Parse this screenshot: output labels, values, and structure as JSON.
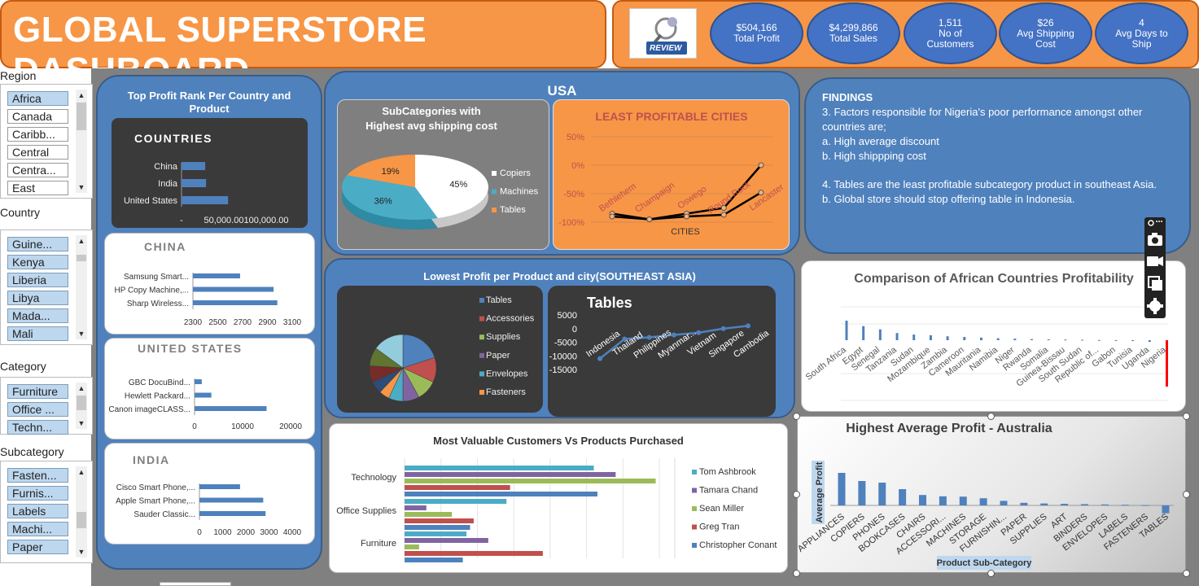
{
  "title": "GLOBAL SUPERSTORE DASHBOARD",
  "logo_text": "REVIEW",
  "kpis": [
    {
      "value": "$504,166",
      "label": "Total Profit"
    },
    {
      "value": "$4,299,866",
      "label": "Total Sales"
    },
    {
      "value": "1,511",
      "label": "No of Customers"
    },
    {
      "value": "$26",
      "label": "Avg Shipping Cost"
    },
    {
      "value": "4",
      "label": "Avg Days to Ship"
    }
  ],
  "slicers": {
    "region": {
      "title": "Region",
      "items": [
        "Africa",
        "Canada",
        "Caribb...",
        "Central",
        "Centra...",
        "East"
      ],
      "selected": [
        0
      ]
    },
    "country": {
      "title": "Country",
      "items": [
        "Guine...",
        "Kenya",
        "Liberia",
        "Libya",
        "Mada...",
        "Mali"
      ],
      "selected": [
        0,
        1,
        2,
        3,
        4,
        5
      ]
    },
    "category": {
      "title": "Category",
      "items": [
        "Furniture",
        "Office ...",
        "Techn..."
      ],
      "selected": [
        0,
        1,
        2
      ]
    },
    "subcategory": {
      "title": "Subcategory",
      "items": [
        "Fasten...",
        "Furnis...",
        "Labels",
        "Machi...",
        "Paper"
      ],
      "selected": [
        0,
        1,
        2,
        3,
        4
      ]
    }
  },
  "left_panel_title": "Top Profit Rank Per Country and Product",
  "usa_panel_title": "USA",
  "sea_panel_title": "Lowest Profit per Product and city(SOUTHEAST ASIA)",
  "findings": {
    "heading": "FINDINGS",
    "lines": [
      "3. Factors responsible for Nigeria's poor performance amongst other countries are;",
      "a. High average discount",
      "b. High shippping cost",
      "",
      "4. Tables are the least profitable subcategory product in southeast Asia.",
      "b. Global store should stop offering table in Indonesia."
    ]
  },
  "chart_data": [
    {
      "id": "countries",
      "type": "bar",
      "orientation": "horizontal",
      "title": "COUNTRIES",
      "categories": [
        "China",
        "India",
        "United States"
      ],
      "values": [
        28000,
        29000,
        55000
      ],
      "xlim": [
        0,
        100000
      ],
      "tick_labels": [
        "-",
        "50,000.00",
        "100,000.00"
      ],
      "colors": [
        "#4f81bd"
      ]
    },
    {
      "id": "china",
      "type": "bar",
      "orientation": "horizontal",
      "title": "CHINA",
      "categories": [
        "Samsung Smart...",
        "HP Copy Machine,...",
        "Sharp Wireless..."
      ],
      "values": [
        2680,
        2950,
        2980
      ],
      "xlim": [
        2300,
        3100
      ],
      "tick_labels": [
        "2300",
        "2500",
        "2700",
        "2900",
        "3100"
      ],
      "colors": [
        "#4f81bd"
      ]
    },
    {
      "id": "united_states",
      "type": "bar",
      "orientation": "horizontal",
      "title": "UNITED STATES",
      "categories": [
        "GBC DocuBind...",
        "Hewlett Packard...",
        "Canon imageCLASS..."
      ],
      "values": [
        1500,
        3500,
        15000
      ],
      "xlim": [
        0,
        20000
      ],
      "tick_labels": [
        "0",
        "10000",
        "20000"
      ],
      "colors": [
        "#4f81bd"
      ]
    },
    {
      "id": "india",
      "type": "bar",
      "orientation": "horizontal",
      "title": "INDIA",
      "categories": [
        "Cisco Smart Phone,...",
        "Apple Smart Phone,...",
        "Sauder Classic..."
      ],
      "values": [
        1750,
        2750,
        2850
      ],
      "xlim": [
        0,
        4000
      ],
      "tick_labels": [
        "0",
        "1000",
        "2000",
        "3000",
        "4000"
      ],
      "colors": [
        "#4f81bd"
      ]
    },
    {
      "id": "usa_shipping_pie",
      "type": "pie",
      "title": "SubCategories with Highest avg shipping cost",
      "categories": [
        "Copiers",
        "Machines",
        "Tables"
      ],
      "values": [
        45,
        36,
        19
      ],
      "labels": [
        "45%",
        "36%",
        "19%"
      ],
      "colors": [
        "#ffffff",
        "#4bacc6",
        "#f79646"
      ],
      "legend": "right"
    },
    {
      "id": "usa_least_profitable",
      "type": "line",
      "title": "LEAST PROFITABLE CITIES",
      "xlabel": "CITIES",
      "categories": [
        "Bethlehem",
        "Champaign",
        "Oswego",
        "Round Rock",
        "Lancaster"
      ],
      "series": [
        {
          "values": [
            -85,
            -95,
            -85,
            -75,
            0
          ],
          "color": "#000000"
        },
        {
          "values": [
            -90,
            -95,
            -90,
            -87,
            -48
          ],
          "color": "#000000"
        }
      ],
      "ylim": [
        -100,
        50
      ],
      "tick_labels": [
        "50%",
        "0%",
        "-50%",
        "-100%"
      ]
    },
    {
      "id": "sea_pie",
      "type": "pie",
      "categories": [
        "Tables",
        "Accessories",
        "Supplies",
        "Paper",
        "Envelopes",
        "Fasteners"
      ],
      "values": [
        20,
        12,
        10,
        8,
        7,
        5,
        6,
        8,
        9,
        15
      ],
      "colors": [
        "#4f81bd",
        "#c0504d",
        "#9bbb59",
        "#8064a2",
        "#4bacc6",
        "#f79646",
        "#2c4d75",
        "#772c2a",
        "#5f7530",
        "#93cddd"
      ],
      "legend": "right"
    },
    {
      "id": "sea_tables",
      "type": "line",
      "title": "Tables",
      "categories": [
        "Indonesia",
        "Thailand",
        "Philippines",
        "Myanmar...",
        "Vietnam",
        "Singapore",
        "Cambodia"
      ],
      "values": [
        -11000,
        -3800,
        -3200,
        -2300,
        -1500,
        0,
        1000
      ],
      "ylim": [
        -15000,
        5000
      ],
      "tick_labels": [
        "5000",
        "0",
        "-5000",
        "-10000",
        "-15000"
      ],
      "colors": [
        "#4f81bd"
      ]
    },
    {
      "id": "african_profitability",
      "type": "bar",
      "title": "Comparison of African Countries Profitability",
      "categories": [
        "South Africa",
        "Egypt",
        "Senegal",
        "Tanzania",
        "Sudan",
        "Mozambique",
        "Zambia",
        "Cameroon",
        "Mauritania",
        "Namibia",
        "Niger",
        "Rwanda",
        "Somalia",
        "Guinea-Bissau",
        "South Sudan",
        "Republic of...",
        "Gabon",
        "Tunisia",
        "Uganda",
        "Nigeria"
      ],
      "values": [
        9000,
        6500,
        5000,
        3300,
        2600,
        2300,
        1800,
        1500,
        1200,
        900,
        700,
        500,
        400,
        300,
        200,
        100,
        50,
        -100,
        -800,
        -3500
      ],
      "colors": [
        "#4f81bd",
        "#ff0000"
      ]
    },
    {
      "id": "australia_avg_profit",
      "type": "bar",
      "title": "Highest Average Profit - Australia",
      "xlabel": "Product Sub-Category",
      "ylabel": "Average Profit",
      "categories": [
        "APPLIANCES",
        "COPIERS",
        "PHONES",
        "BOOKCASES",
        "CHAIRS",
        "ACCESSORI...",
        "MACHINES",
        "STORAGE",
        "FURNISHIN...",
        "PAPER",
        "SUPPLIES",
        "ART",
        "BINDERS",
        "ENVELOPES",
        "LABELS",
        "FASTENERS",
        "TABLES"
      ],
      "values": [
        100,
        75,
        70,
        50,
        32,
        28,
        27,
        22,
        14,
        8,
        6,
        5,
        4,
        3,
        2,
        1,
        -60
      ],
      "colors": [
        "#4f81bd"
      ]
    },
    {
      "id": "valuable_customers",
      "type": "bar",
      "orientation": "horizontal",
      "title": "Most Valuable Customers Vs Products Purchased",
      "categories": [
        "Technology",
        "Office Supplies",
        "Furniture"
      ],
      "series": [
        {
          "name": "Tom Ashbrook",
          "values": [
            5.2,
            2.8,
            1.7
          ]
        },
        {
          "name": "Tamara Chand",
          "values": [
            5.8,
            0.6,
            2.3
          ]
        },
        {
          "name": "Sean Miller",
          "values": [
            6.9,
            1.3,
            0.4
          ]
        },
        {
          "name": "Greg Tran",
          "values": [
            2.9,
            1.9,
            3.8
          ]
        },
        {
          "name": "Christopher Conant",
          "values": [
            5.3,
            1.8,
            1.6
          ]
        }
      ],
      "colors": [
        "#4bacc6",
        "#8064a2",
        "#9bbb59",
        "#c0504d",
        "#4f81bd"
      ],
      "legend": "right"
    }
  ]
}
